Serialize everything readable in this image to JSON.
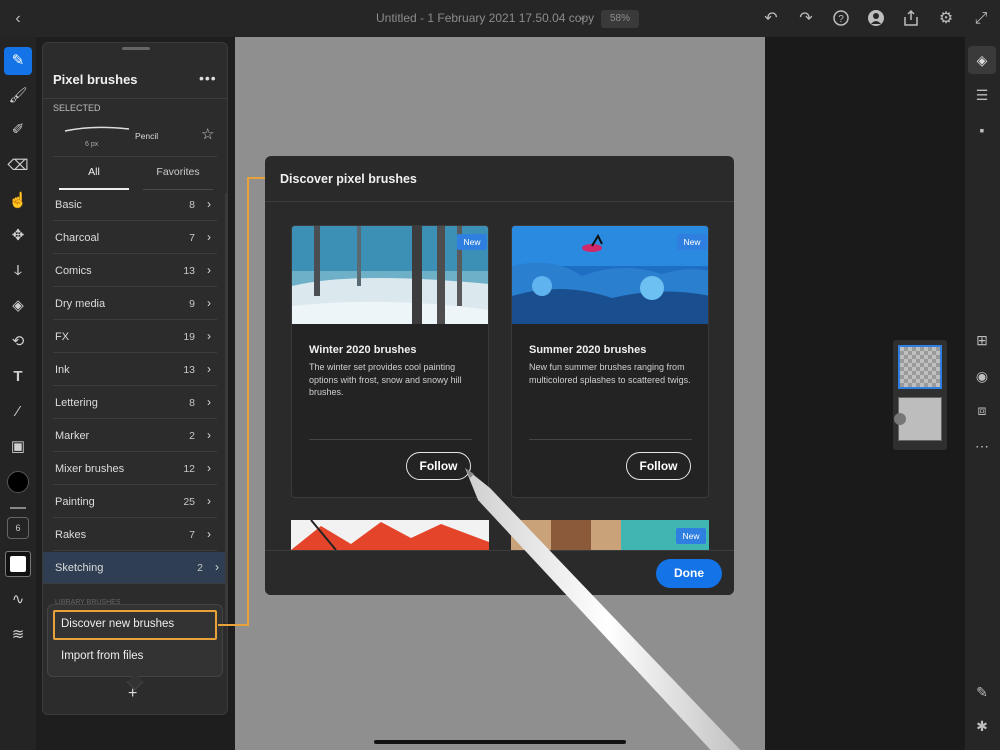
{
  "topbar": {
    "doc_title": "Untitled - 1 February 2021 17.50.04 copy",
    "zoom": "58%"
  },
  "icons": {
    "back": "chevron-left-icon",
    "undo": "undo-icon",
    "redo": "redo-icon",
    "help": "help-icon",
    "invite": "invite-icon",
    "share": "share-icon",
    "settings": "gear-icon",
    "expand": "expand-icon"
  },
  "toolbar": {
    "size_value": "6"
  },
  "panel": {
    "title": "Pixel brushes",
    "selected_label": "SELECTED",
    "selected_brush_name": "Pencil",
    "selected_brush_size": "6 px",
    "tabs": [
      "All",
      "Favorites"
    ],
    "categories": [
      {
        "name": "Basic",
        "count": "8"
      },
      {
        "name": "Charcoal",
        "count": "7"
      },
      {
        "name": "Comics",
        "count": "13"
      },
      {
        "name": "Dry media",
        "count": "9"
      },
      {
        "name": "FX",
        "count": "19"
      },
      {
        "name": "Ink",
        "count": "13"
      },
      {
        "name": "Lettering",
        "count": "8"
      },
      {
        "name": "Marker",
        "count": "2"
      },
      {
        "name": "Mixer brushes",
        "count": "12"
      },
      {
        "name": "Painting",
        "count": "25"
      },
      {
        "name": "Rakes",
        "count": "7"
      },
      {
        "name": "Sketching",
        "count": "2"
      }
    ],
    "library_label": "LIBRARY BRUSHES",
    "add_label": "+"
  },
  "menu": {
    "discover": "Discover new brushes",
    "import": "Import from files"
  },
  "modal": {
    "title": "Discover pixel brushes",
    "cards": [
      {
        "title": "Winter 2020 brushes",
        "desc": "The winter set provides cool painting options with frost, snow and snowy hill brushes.",
        "badge": "New",
        "button": "Follow"
      },
      {
        "title": "Summer 2020 brushes",
        "desc": "New fun summer brushes ranging from multicolored splashes to scattered twigs.",
        "badge": "New",
        "button": "Follow"
      }
    ],
    "third_badge": "New",
    "done_label": "Done"
  },
  "colors": {
    "accent_blue": "#1473e6",
    "highlight_orange": "#e8a23a",
    "panel_bg": "#2c2c2c"
  }
}
